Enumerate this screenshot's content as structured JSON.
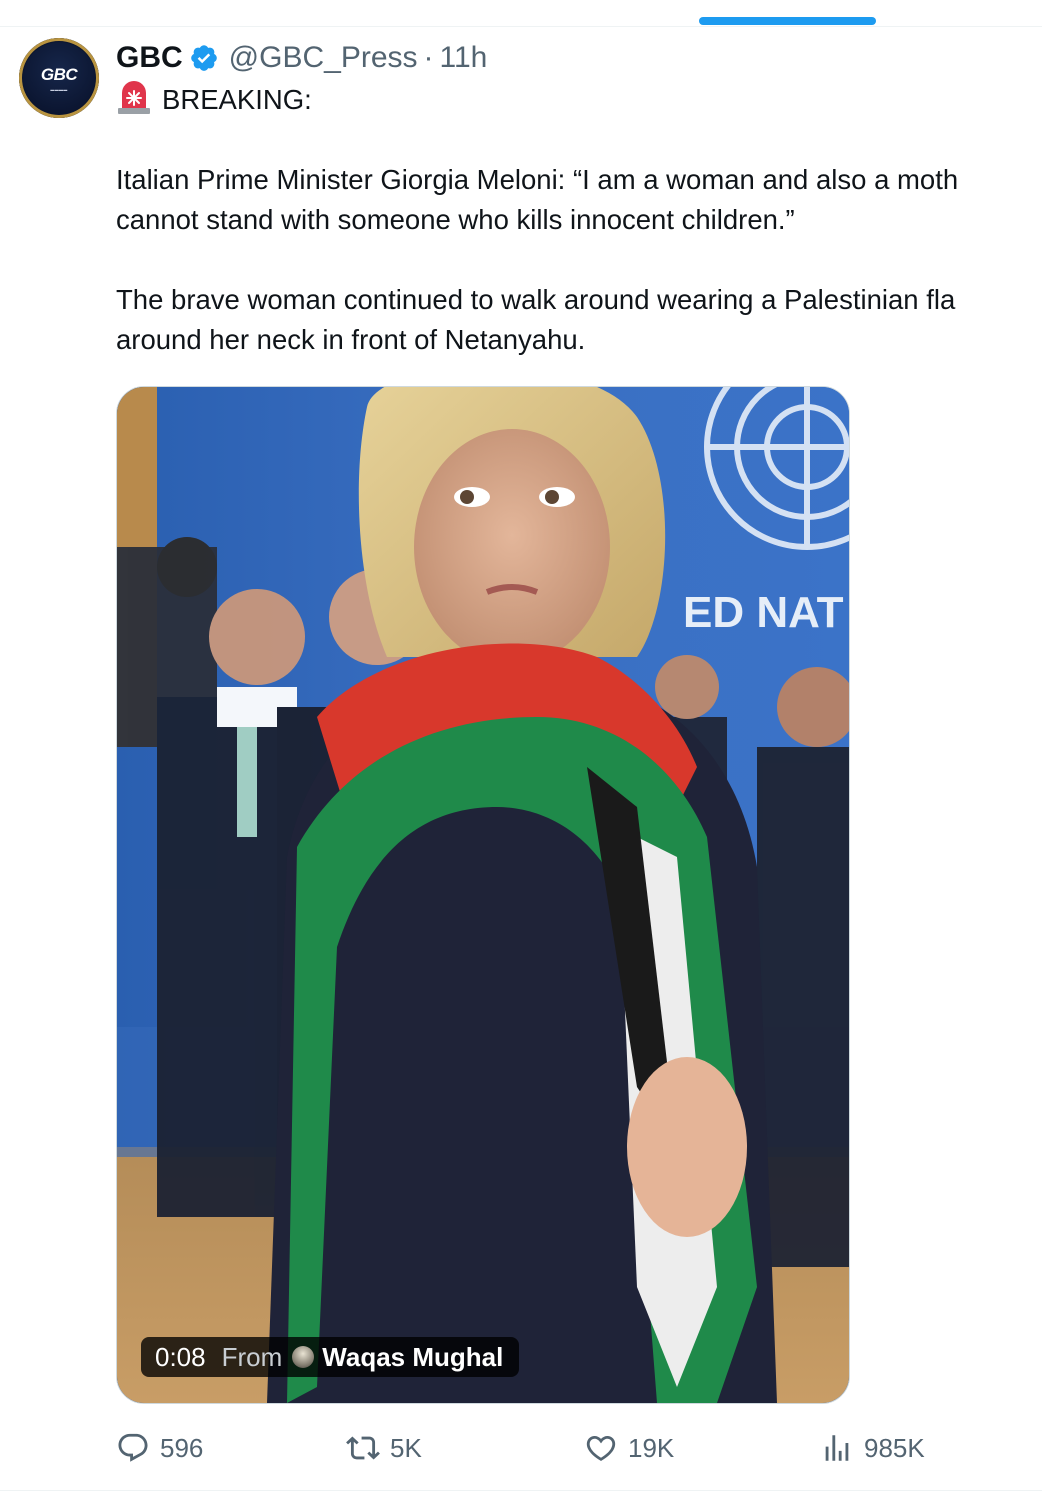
{
  "tweet": {
    "author": {
      "display_name": "GBC",
      "handle": "@GBC_Press",
      "separator": "·",
      "time": "11h",
      "verified": true,
      "avatar_text": "GBC",
      "avatar_icon": "gbc-logo"
    },
    "text_lines": [
      "BREAKING:",
      "",
      "Italian Prime Minister Giorgia Meloni: “I am a woman and also a moth",
      "cannot stand with someone who kills innocent children.”",
      "",
      "The brave woman continued to walk around wearing a Palestinian fla",
      "around her neck in front of Netanyahu."
    ],
    "leading_emoji": "siren-icon",
    "media": {
      "type": "video",
      "duration": "0:08",
      "from_label": "From",
      "source_name": "Waqas Mughal",
      "background_text": "ED NAT"
    },
    "actions": {
      "replies": "596",
      "reposts": "5K",
      "likes": "19K",
      "views": "985K"
    }
  },
  "colors": {
    "accent": "#1d9bf0",
    "text": "#0f1419",
    "muted": "#536471",
    "border": "#cfd9de"
  }
}
